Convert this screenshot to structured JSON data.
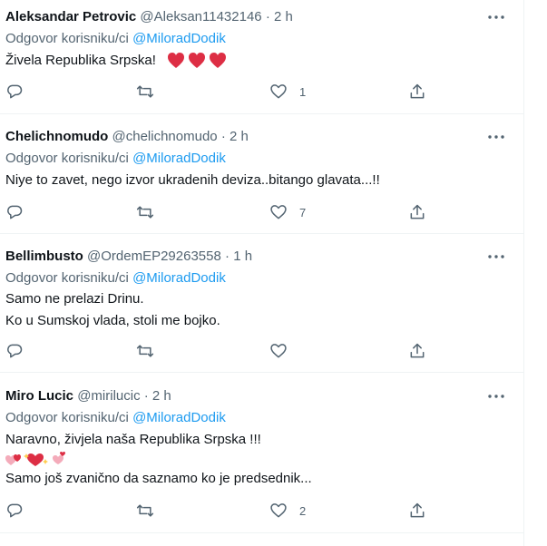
{
  "colors": {
    "accent": "#1d9bf0",
    "muted": "#536471",
    "heart": "#f91880",
    "text": "#0f1419"
  },
  "icons": {
    "more": "more-icon",
    "reply": "reply-icon",
    "retweet": "retweet-icon",
    "like": "heart-icon",
    "share": "share-icon"
  },
  "tweets": [
    {
      "name": "Aleksandar Petrovic",
      "handle": "@Aleksan11432146",
      "sep": "·",
      "time": "2 h",
      "reply_prefix": "Odgovor korisniku/ci",
      "reply_mention": "@MiloradDodik",
      "lines": [
        "Živela Republika Srpska!"
      ],
      "likes": "1"
    },
    {
      "name": "Chelichnomudo",
      "handle": "@chelichnomudo",
      "sep": "·",
      "time": "2 h",
      "reply_prefix": "Odgovor korisniku/ci",
      "reply_mention": "@MiloradDodik",
      "lines": [
        "Niye to zavet, nego izvor ukradenih deviza..bitango glavata...!!"
      ],
      "likes": "7"
    },
    {
      "name": "Bellimbusto",
      "handle": "@OrdemEP29263558",
      "sep": "·",
      "time": "1 h",
      "reply_prefix": "Odgovor korisniku/ci",
      "reply_mention": "@MiloradDodik",
      "lines": [
        "Samo ne prelazi Drinu.",
        "Ko u Sumskoj vlada, stoli me bojko."
      ],
      "likes": ""
    },
    {
      "name": "Miro Lucic",
      "handle": "@mirilucic",
      "sep": "·",
      "time": "2 h",
      "reply_prefix": "Odgovor korisniku/ci",
      "reply_mention": "@MiloradDodik",
      "lines": [
        "Naravno, živjela naša Republika Srpska !!!",
        "Samo još  zvanično da saznamo ko je predsednik..."
      ],
      "likes": "2"
    }
  ]
}
